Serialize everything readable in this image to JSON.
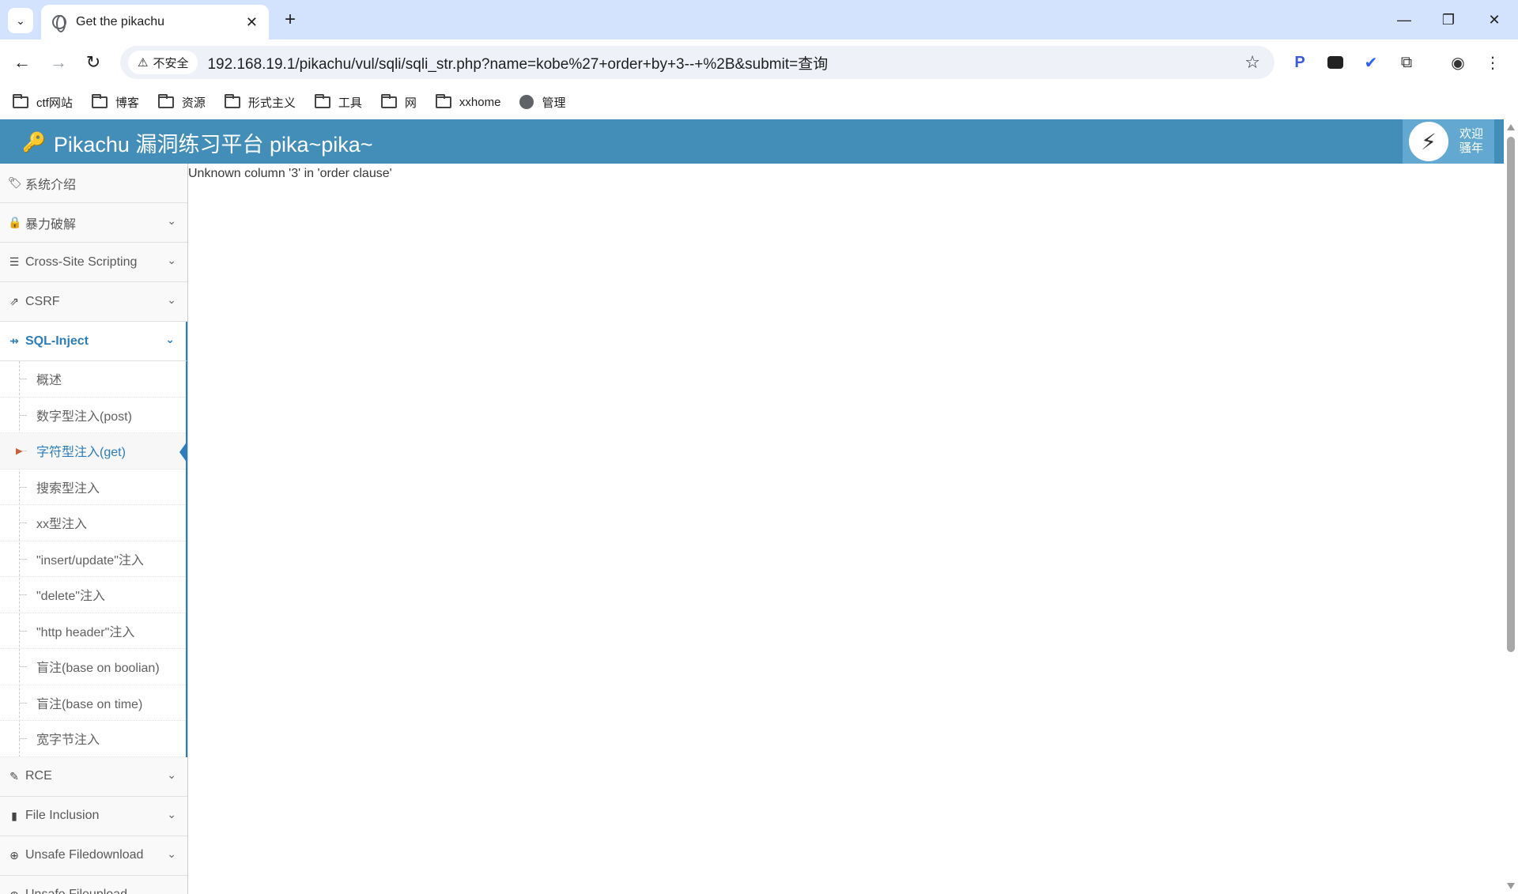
{
  "browser": {
    "tab_title": "Get the pikachu",
    "security_label": "不安全",
    "url": "192.168.19.1/pikachu/vul/sqli/sqli_str.php?name=kobe%27+order+by+3--+%2B&submit=查询",
    "bookmarks": [
      "ctf网站",
      "博客",
      "资源",
      "形式主义",
      "工具",
      "网",
      "xxhome",
      "管理"
    ]
  },
  "header": {
    "brand": "Pikachu 漏洞练习平台 pika~pika~",
    "welcome_line1": "欢迎",
    "welcome_line2": "骚年"
  },
  "sidebar": {
    "items": [
      {
        "label": "系统介绍"
      },
      {
        "label": "暴力破解"
      },
      {
        "label": "Cross-Site Scripting"
      },
      {
        "label": "CSRF"
      },
      {
        "label": "SQL-Inject"
      },
      {
        "label": "RCE"
      },
      {
        "label": "File Inclusion"
      },
      {
        "label": "Unsafe Filedownload"
      },
      {
        "label": "Unsafe Fileupload"
      }
    ],
    "sql_submenu": [
      "概述",
      "数字型注入(post)",
      "字符型注入(get)",
      "搜索型注入",
      "xx型注入",
      "\"insert/update\"注入",
      "\"delete\"注入",
      "\"http header\"注入",
      "盲注(base on boolian)",
      "盲注(base on time)",
      "宽字节注入"
    ]
  },
  "content": {
    "error_message": "Unknown column '3' in 'order clause'"
  }
}
